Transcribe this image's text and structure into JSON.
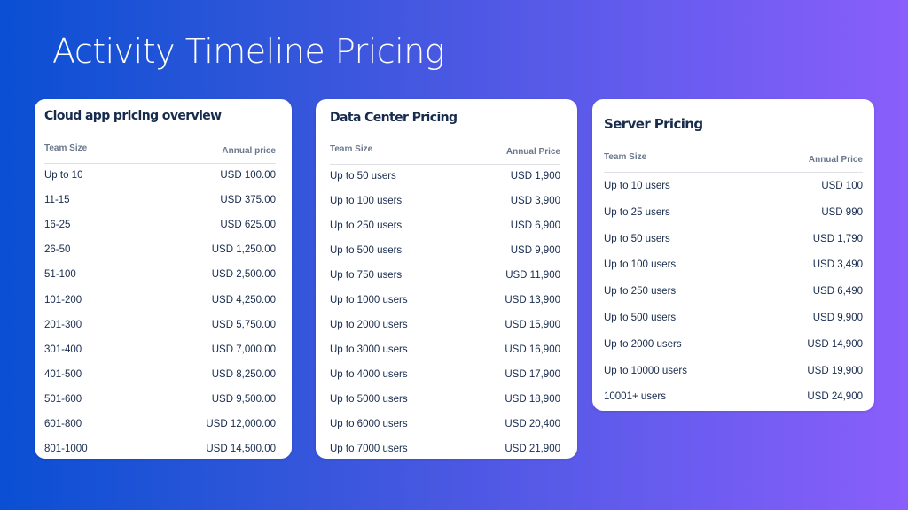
{
  "page": {
    "title": "Activity Timeline Pricing"
  },
  "cards": {
    "cloud": {
      "title": "Cloud app pricing overview",
      "col_size": "Team Size",
      "col_price": "Annual price",
      "rows": [
        {
          "size": "Up to 10",
          "price": "USD 100.00"
        },
        {
          "size": "11-15",
          "price": "USD 375.00"
        },
        {
          "size": "16-25",
          "price": "USD 625.00"
        },
        {
          "size": "26-50",
          "price": "USD 1,250.00"
        },
        {
          "size": "51-100",
          "price": "USD 2,500.00"
        },
        {
          "size": "101-200",
          "price": "USD 4,250.00"
        },
        {
          "size": "201-300",
          "price": "USD 5,750.00"
        },
        {
          "size": "301-400",
          "price": "USD 7,000.00"
        },
        {
          "size": "401-500",
          "price": "USD 8,250.00"
        },
        {
          "size": "501-600",
          "price": "USD 9,500.00"
        },
        {
          "size": "601-800",
          "price": "USD 12,000.00"
        },
        {
          "size": "801-1000",
          "price": "USD 14,500.00"
        }
      ]
    },
    "data_center": {
      "title": "Data Center Pricing",
      "col_size": "Team Size",
      "col_price": "Annual Price",
      "rows": [
        {
          "size": "Up to 50 users",
          "price": "USD 1,900"
        },
        {
          "size": "Up to 100 users",
          "price": "USD 3,900"
        },
        {
          "size": "Up to 250 users",
          "price": "USD 6,900"
        },
        {
          "size": "Up to 500 users",
          "price": "USD 9,900"
        },
        {
          "size": "Up to 750 users",
          "price": "USD 11,900"
        },
        {
          "size": "Up to 1000 users",
          "price": "USD 13,900"
        },
        {
          "size": "Up to 2000 users",
          "price": "USD 15,900"
        },
        {
          "size": "Up to 3000 users",
          "price": "USD 16,900"
        },
        {
          "size": "Up to 4000 users",
          "price": "USD 17,900"
        },
        {
          "size": "Up to 5000 users",
          "price": "USD 18,900"
        },
        {
          "size": "Up to 6000 users",
          "price": "USD 20,400"
        },
        {
          "size": "Up to 7000 users",
          "price": "USD 21,900"
        }
      ]
    },
    "server": {
      "title": "Server Pricing",
      "col_size": "Team Size",
      "col_price": "Annual Price",
      "rows": [
        {
          "size": "Up to 10 users",
          "price": "USD 100"
        },
        {
          "size": "Up to 25 users",
          "price": "USD 990"
        },
        {
          "size": "Up to 50 users",
          "price": "USD 1,790"
        },
        {
          "size": "Up to 100 users",
          "price": "USD 3,490"
        },
        {
          "size": "Up to 250 users",
          "price": "USD 6,490"
        },
        {
          "size": "Up to 500 users",
          "price": "USD 9,900"
        },
        {
          "size": "Up to 2000 users",
          "price": "USD 14,900"
        },
        {
          "size": "Up to 10000 users",
          "price": "USD 19,900"
        },
        {
          "size": "10001+ users",
          "price": "USD 24,900"
        }
      ]
    }
  },
  "colors": {
    "gradient_start": "#0a4fd4",
    "gradient_end": "#8a5efb",
    "card_bg": "#ffffff",
    "title_text": "#172b4d",
    "header_text": "#6b778c"
  }
}
